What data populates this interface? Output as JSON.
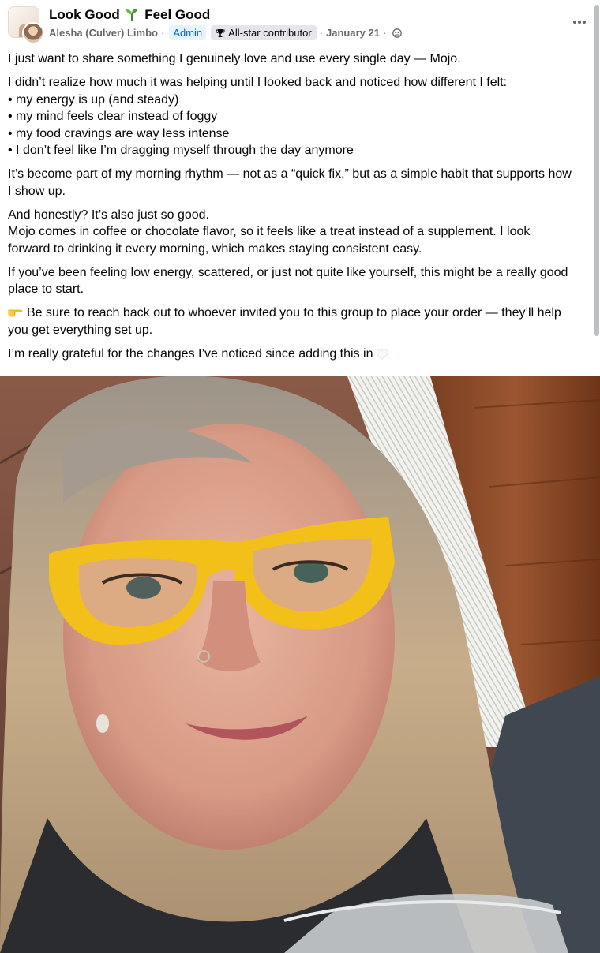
{
  "post": {
    "group_name_part1": "Look Good",
    "group_name_part2": "Feel Good",
    "author": "Alesha (Culver) Limbo",
    "separator": "·",
    "admin_badge": "Admin",
    "contributor_badge": "All-star contributor",
    "date": "January 21",
    "more_icon": "more-horizontal-icon",
    "paragraphs": [
      [
        "I just want to share something I genuinely love and use every single day — Mojo."
      ],
      [
        "I didn’t realize how much it was helping until I looked back and noticed how different I felt:",
        "• my energy is up (and steady)",
        "• my mind feels clear instead of foggy",
        "• my food cravings are way less intense",
        "• I don’t feel like I’m dragging myself through the day anymore"
      ],
      [
        "It’s become part of my morning rhythm — not as a “quick fix,” but as a simple habit that supports how",
        "I show up."
      ],
      [
        "And honestly? It’s also just so good.",
        "Mojo comes in coffee or chocolate flavor, so it feels like a treat instead of a supplement. I look",
        "forward to drinking it every morning, which makes staying consistent easy."
      ],
      [
        "If you’ve been feeling low energy, scattered, or just not quite like yourself, this might be a really good",
        "place to start."
      ]
    ],
    "cta_line1": "Be sure to reach back out to whoever invited you to this group to place your order — they’ll help",
    "cta_line2": "you get everything set up.",
    "closing": "I’m really grateful for the changes I’ve noticed since adding this in",
    "icons": {
      "sprout": "sprout-emoji-icon",
      "trophy": "trophy-icon",
      "globe": "group-privacy-icon",
      "hand": "pointing-hand-emoji-icon",
      "heart": "white-heart-emoji-icon"
    },
    "colors": {
      "admin_text": "#0064d1",
      "admin_bg": "#e7f3ff",
      "meta_text": "#65676b",
      "glasses": "#f2c018"
    }
  }
}
